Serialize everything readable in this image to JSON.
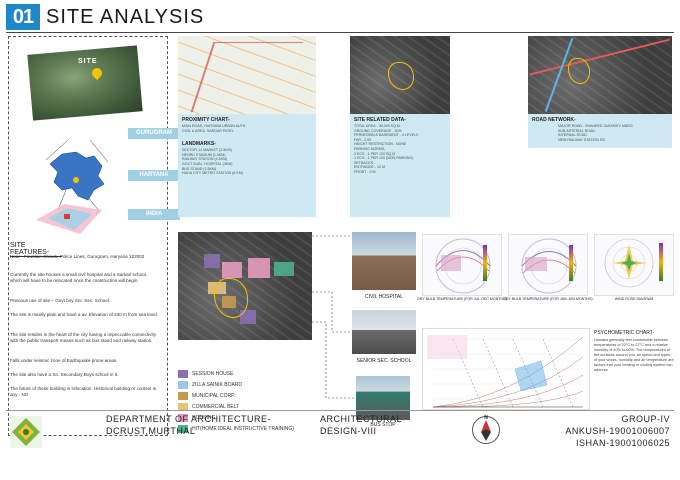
{
  "title": {
    "number": "01",
    "text": "SITE ANALYSIS"
  },
  "left": {
    "site_label": "SITE",
    "regions": {
      "gurugram": "GURUGRAM",
      "haryana": "HARYANA",
      "india": "INDIA"
    },
    "features_heading": "SITE FEATURES-",
    "features": [
      "Near - Fountain Chowk, Police Lines, Gurugram, Haryana 122002",
      "Currently the site houses a small civil hospital and a Sarkari school, which will have to be relocated once the construction will begin.",
      "Previous use of site – Govt boy Snr. Sec. School.",
      "The site is mainly plain and have a av. Elevation of 230 m from sea level.",
      "The site resides in the heart of the city having a impeccable connectivity with the public transport means such as bus stand and railway station.",
      "Falls under seismic zone of Earthquake prone areas.",
      "The site also have a Sn. Secondary Boys school in it.",
      "The future of these building is relocation. Historical building or context is any - NO"
    ]
  },
  "proximity": {
    "heading": "PROXIMITY CHART-",
    "lines": [
      "MAIN ROAD, HARYANA URBAN AUTH.",
      "CIVIL & AREA, SARDAR PATEL"
    ],
    "landmarks_heading": "LANDMARKS-",
    "landmarks": [
      "SECTOR-14 MARKET (2.5KM)",
      "NEHRU STADIUM (1.5KM)",
      "RAILWAY STATION (4.5KM)",
      "GOVT SUBJ. HOSPITAL (3KM)",
      "BUS STAND (1.5KM)",
      "HUDA CITY METRO STATION (6 KM)"
    ]
  },
  "site_related": {
    "heading": "SITE RELATED DATA-",
    "lines": [
      "TOTAL AREA - 30,000 SQ.M",
      "GROUND COVERAGE - 30%",
      "PERMISSIBLE BASEMENT - 4 LEVELS",
      "FAR - 2.50",
      "HEIGHT RESTRICTION - NONE",
      "",
      "PARKING NORMS-",
      "2 ECS - 1 PER 100 SQ.M",
      "1 ECS - 1 PER 100 (NON-PARKING)",
      "",
      "SETBACKS -",
      "ENTRANCE - 12 M",
      "FRONT - 9 M"
    ]
  },
  "road": {
    "heading": "ROAD NETWORK-",
    "lines": [
      "MAJOR ROAD - SHAHEED SUKHDEV MARG",
      "SUB ARTERIAL ROAD",
      "INTERNAL ROAD",
      "NEW RAILWAY STATION RD"
    ]
  },
  "legend": [
    {
      "label": "SESSION HOUSE",
      "color": "#8a6fb3"
    },
    {
      "label": "ZILLA SAINIK BOARD",
      "color": "#9fc6e6"
    },
    {
      "label": "MUNICIPAL CORP.",
      "color": "#c79a4f"
    },
    {
      "label": "COMMERCIAL BELT",
      "color": "#e7c37a"
    },
    {
      "label": "HOUSING",
      "color": "#e59bbd"
    },
    {
      "label": "HIT(HOME IDEAL INSTRUCTIVE TRAINING)",
      "color": "#4db08a"
    }
  ],
  "photos": {
    "hospital": "CIVIL HOSPITAL",
    "school": "SENIOR SEC. SCHOOL",
    "bus": "BUS STOP"
  },
  "climate": {
    "solar_1_caption": "DRY BULB TEMPERATURE (FOR JUL-DEC MONTHS)",
    "solar_2_caption": "DRY BULB TEMPERATURE (FOR JAN-JUN MONTHS)",
    "wind_caption": "WIND ROSE DIAGRAM",
    "psy_heading": "PSYCHOMETRIC CHART-",
    "psy_text": "Humans generally feel comfortable between temperatures of 22°C to 27°C and a relative humidity of 40% to 60%. The temperatures of the surfaces around you, air speed and types of your works, humidity and air temperature are factors that your heating or cooling system can address."
  },
  "footer": {
    "dept_line1": "DEPARTMENT OF ARCHITECTURE-",
    "dept_line2": "DCRUST,MURTHAL",
    "design_line1": "ARCHITECTURAL",
    "design_line2": "DESIGN-VIII",
    "group": "GROUP-IV",
    "student1": "ANKUSH-19001006007",
    "student2": "ISHAN-19001006025",
    "compass_letter": "N"
  }
}
